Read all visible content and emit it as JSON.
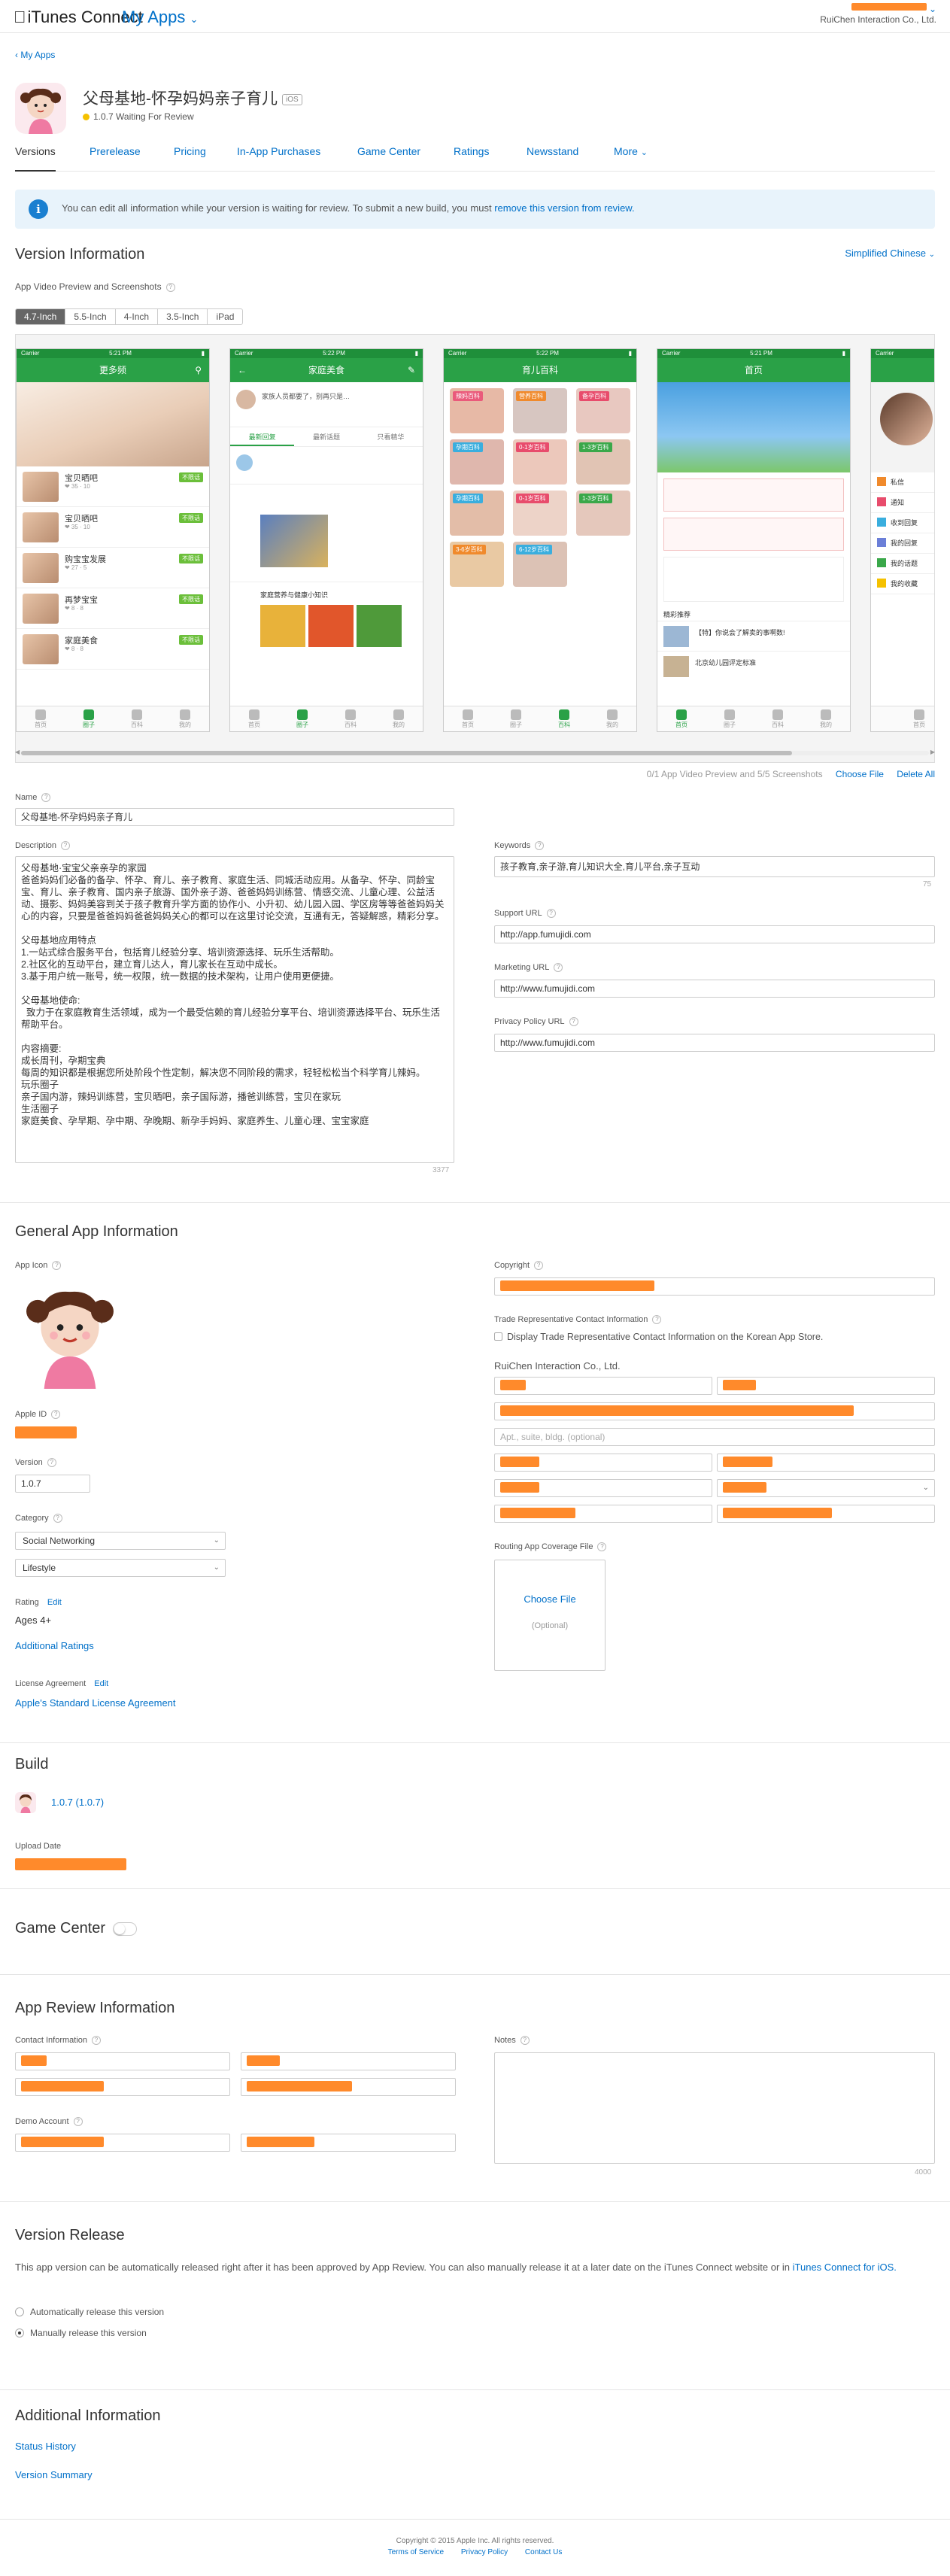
{
  "header": {
    "brand": "iTunes Connect",
    "my_apps": "My Apps",
    "account_company": "RuiChen Interaction Co., Ltd."
  },
  "breadcrumb": "My Apps",
  "app": {
    "name": "父母基地-怀孕妈妈亲子育儿",
    "platform_badge": "iOS",
    "status": "1.0.7 Waiting For Review"
  },
  "tabs": [
    "Versions",
    "Prerelease",
    "Pricing",
    "In-App Purchases",
    "Game Center",
    "Ratings",
    "Newsstand",
    "More"
  ],
  "notice": {
    "text": "You can edit all information while your version is waiting for review. To submit a new build, you must ",
    "link": "remove this version from review."
  },
  "version_info": {
    "title": "Version Information",
    "language": "Simplified Chinese",
    "preview_label": "App Video Preview and Screenshots",
    "device_tabs": [
      "4.7-Inch",
      "5.5-Inch",
      "4-Inch",
      "3.5-Inch",
      "iPad"
    ],
    "shots_count": "0/1 App Video Preview and 5/5 Screenshots",
    "choose_file": "Choose File",
    "delete_all": "Delete All"
  },
  "screens": {
    "s1": {
      "title": "更多频",
      "items": [
        {
          "t": "宝贝晒吧",
          "tag": "不限话"
        },
        {
          "t": "宝贝晒吧",
          "tag": "不限话"
        },
        {
          "t": "购宝宝发展",
          "tag": "不限话"
        },
        {
          "t": "再梦宝宝",
          "tag": "不限话"
        },
        {
          "t": "家庭美食",
          "tag": "不限话"
        }
      ]
    },
    "s2": {
      "title": "家庭美食",
      "tabs": [
        "最新回复",
        "最新话题",
        "只看精华"
      ],
      "post": "家庭营养与健康小知识"
    },
    "s3": {
      "title": "育儿百科",
      "tiles": [
        "辣妈百科",
        "营养百科",
        "备孕百科",
        "孕期百科",
        "0-1岁百科",
        "1-3岁百科",
        "孕期百科",
        "0-1岁百科",
        "1-3岁百科",
        "3-6岁百科",
        "6-12岁百科"
      ]
    },
    "s4": {
      "title": "首页",
      "section": "精彩推荐",
      "rows": [
        "【特】你说会了解卖的事啊数!",
        "北京幼儿园评定标准"
      ]
    },
    "s5": {
      "items": [
        "私信",
        "通知",
        "收到回复",
        "我的回复",
        "我的话题",
        "我的收藏"
      ]
    },
    "status_time": [
      "5:21 PM",
      "5:22 PM",
      "5:22 PM",
      "5:21 PM"
    ],
    "carrier": "Carrier",
    "tabbar": [
      "首页",
      "圈子",
      "百科",
      "我的"
    ]
  },
  "form": {
    "name_label": "Name",
    "name": "父母基地-怀孕妈妈亲子育儿",
    "description_label": "Description",
    "description": "父母基地·宝宝父亲亲孕的家园\n爸爸妈妈们必备的备孕、怀孕、育儿、亲子教育、家庭生活、同城活动应用。从备孕、怀孕、同龄宝宝、育儿、亲子教育、国内亲子旅游、国外亲子游、爸爸妈妈训练营、情感交流、儿童心理、公益活动、摄影、妈妈美容到关于孩子教育升学方面的协作小、小升初、幼儿园入园、学区房等等爸爸妈妈关心的内容，只要是爸爸妈妈爸爸妈妈关心的都可以在这里讨论交流，互通有无，答疑解惑，精彩分享。\n\n父母基地应用特点\n1.一站式综合服务平台，包括育儿经验分享、培训资源选择、玩乐生活帮助。\n2.社区化的互动平台，建立育儿达人，育儿家长在互动中成长。\n3.基于用户统一账号，统一权限，统一数据的技术架构，让用户使用更便捷。\n\n父母基地使命:\n  致力于在家庭教育生活领域，成为一个最受信赖的育儿经验分享平台、培训资源选择平台、玩乐生活帮助平台。\n\n内容摘要:\n成长周刊，孕期宝典\n每周的知识都是根据您所处阶段个性定制，解决您不同阶段的需求，轻轻松松当个科学育儿辣妈。\n玩乐圈子\n亲子国内游，辣妈训练营，宝贝晒吧，亲子国际游，播爸训练营，宝贝在家玩\n生活圈子\n家庭美食、孕早期、孕中期、孕晚期、新孕手妈妈、家庭养生、儿童心理、宝宝家庭",
    "description_count": "3377",
    "keywords_label": "Keywords",
    "keywords": "孩子教育,亲子游,育儿知识大全,育儿平台,亲子互动",
    "keywords_count": "75",
    "support_label": "Support URL",
    "support": "http://app.fumujidi.com",
    "marketing_label": "Marketing URL",
    "marketing": "http://www.fumujidi.com",
    "privacy_label": "Privacy Policy URL",
    "privacy": "http://www.fumujidi.com"
  },
  "general": {
    "title": "General App Information",
    "app_icon_label": "App Icon",
    "apple_id_label": "Apple ID",
    "version_label": "Version",
    "version": "1.0.7",
    "category_label": "Category",
    "primary_category": "Social Networking",
    "secondary_category": "Lifestyle",
    "rating_label": "Rating",
    "rating_edit": "Edit",
    "rating_value": "Ages 4+",
    "additional_ratings": "Additional Ratings",
    "license_label": "License Agreement",
    "license_edit": "Edit",
    "license_link": "Apple's Standard License Agreement",
    "copyright_label": "Copyright",
    "trade_rep_label": "Trade Representative Contact Information",
    "trade_rep_check": "Display Trade Representative Contact Information on the Korean App Store.",
    "company": "RuiChen Interaction Co., Ltd.",
    "apt_placeholder": "Apt., suite, bldg. (optional)",
    "routing_label": "Routing App Coverage File",
    "choose_file": "Choose File",
    "optional": "(Optional)"
  },
  "build": {
    "title": "Build",
    "version": "1.0.7 (1.0.7)",
    "upload_label": "Upload Date"
  },
  "game_center": {
    "title": "Game Center"
  },
  "review": {
    "title": "App Review Information",
    "contact_label": "Contact Information",
    "demo_label": "Demo Account",
    "notes_label": "Notes",
    "notes_count": "4000"
  },
  "release": {
    "title": "Version Release",
    "text": "This app version can be automatically released right after it has been approved by App Review. You can also manually release it at a later date on the iTunes Connect website or in ",
    "link": "iTunes Connect for iOS.",
    "auto": "Automatically release this version",
    "manual": "Manually release this version"
  },
  "additional": {
    "title": "Additional Information",
    "status_history": "Status History",
    "version_summary": "Version Summary"
  },
  "footer": {
    "copyright": "Copyright © 2015 Apple Inc. All rights reserved.",
    "links": [
      "Terms of Service",
      "Privacy Policy",
      "Contact Us"
    ]
  },
  "colors": {
    "link": "#0070c9",
    "redaction": "#ff8a2b",
    "app_green": "#2aa147",
    "notice_bg": "#e8f3fb"
  }
}
